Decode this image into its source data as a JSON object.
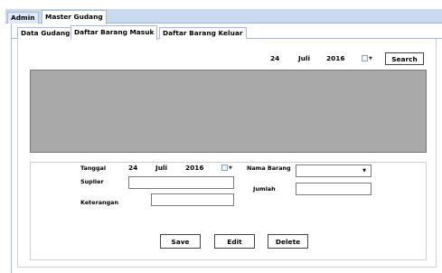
{
  "outer_tabs": [
    {
      "label": "Admin"
    },
    {
      "label": "Master Gudang"
    }
  ],
  "inner_tabs": [
    {
      "label": "Data Gudang"
    },
    {
      "label": "Daftar Barang Masuk"
    },
    {
      "label": "Daftar Barang Keluar"
    }
  ],
  "search_date": {
    "day": "24",
    "month": "Juli",
    "year": "2016"
  },
  "search_button": "Search",
  "form": {
    "tanggal_label": "Tanggal",
    "tanggal": {
      "day": "24",
      "month": "Juli",
      "year": "2016"
    },
    "suplier_label": "Suplier",
    "suplier_value": "",
    "keterangan_label": "Keterangan",
    "keterangan_value": "",
    "nama_barang_label": "Nama Barang",
    "nama_barang_value": "",
    "jumlah_label": "Jumlah",
    "jumlah_value": ""
  },
  "buttons": {
    "save": "Save",
    "edit": "Edit",
    "delete": "Delete"
  },
  "colors": {
    "grid_bg": "#a9a9a9",
    "tabbar_bg": "#c9d9ee"
  }
}
